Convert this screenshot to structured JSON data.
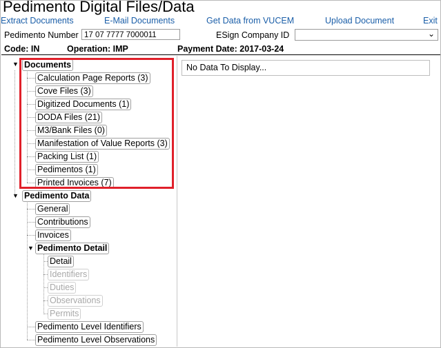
{
  "header": {
    "title": "Pedimento Digital Files/Data"
  },
  "actions": [
    {
      "label": "Extract Documents"
    },
    {
      "label": "E-Mail Documents"
    },
    {
      "label": "Get Data from VUCEM"
    },
    {
      "label": "Upload Document"
    },
    {
      "label": "Exit"
    }
  ],
  "form": {
    "pedimento_label": "Pedimento Number",
    "pedimento_value": "17 07 7777 7000011",
    "esign_label": "ESign Company ID",
    "esign_value": ""
  },
  "info": {
    "code": "Code: IN",
    "operation": "Operation: IMP",
    "payment": "Payment Date: 2017-03-24"
  },
  "data_panel": {
    "empty_text": "No Data To Display..."
  },
  "tree": {
    "documents": {
      "label": "Documents",
      "items": [
        {
          "label": "Calculation Page Reports (3)"
        },
        {
          "label": "Cove Files (3)"
        },
        {
          "label": "Digitized Documents (1)"
        },
        {
          "label": "DODA Files (21)"
        },
        {
          "label": "M3/Bank Files (0)"
        },
        {
          "label": "Manifestation of Value Reports (3)"
        },
        {
          "label": "Packing List (1)"
        },
        {
          "label": "Pedimentos (1)"
        },
        {
          "label": "Printed Invoices (7)"
        }
      ]
    },
    "pedimento_data": {
      "label": "Pedimento Data",
      "items": [
        {
          "label": "General"
        },
        {
          "label": "Contributions"
        },
        {
          "label": "Invoices"
        }
      ],
      "detail": {
        "label": "Pedimento Detail",
        "items": [
          {
            "label": "Detail",
            "enabled": true
          },
          {
            "label": "Identifiers",
            "enabled": false
          },
          {
            "label": "Duties",
            "enabled": false
          },
          {
            "label": "Observations",
            "enabled": false
          },
          {
            "label": "Permits",
            "enabled": false
          }
        ]
      },
      "after": [
        {
          "label": "Pedimento Level Identifiers"
        },
        {
          "label": "Pedimento Level Observations"
        }
      ]
    }
  },
  "colors": {
    "link": "#1a5ea8",
    "highlight": "#e0202a"
  },
  "icons": {
    "expanded": "triangle-down-icon",
    "dropdown": "chevron-down-icon"
  }
}
